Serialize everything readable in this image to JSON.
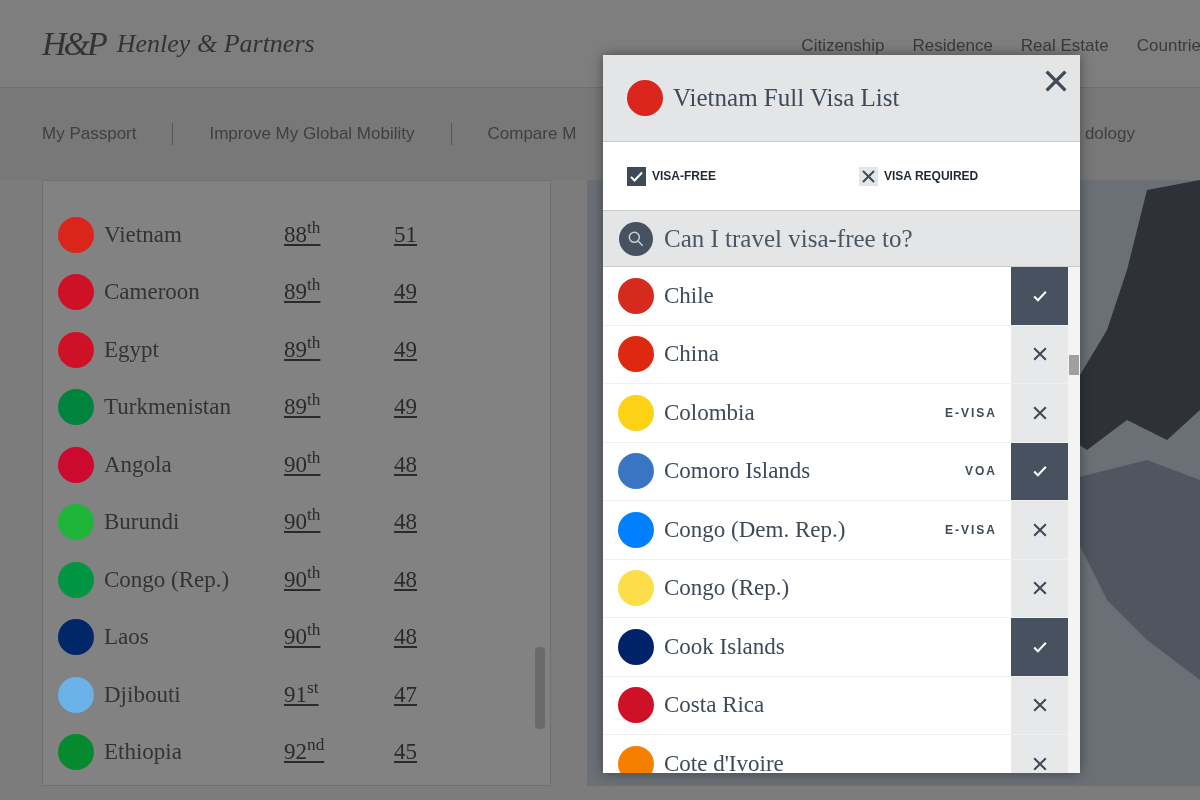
{
  "header": {
    "logo_mark": "H&P",
    "brand": "Henley & Partners",
    "nav": [
      "Citizenship",
      "Residence",
      "Real Estate",
      "Countrie"
    ]
  },
  "subnav": {
    "items": [
      "My Passport",
      "Improve My Global Mobility",
      "Compare M"
    ],
    "right_item": "dology"
  },
  "ranking": {
    "rows": [
      {
        "country": "Vietnam",
        "rank": "88$^{th}$",
        "score": "51",
        "color": "#da251d"
      },
      {
        "country": "Cameroon",
        "rank": "89$^{th}$",
        "score": "49",
        "color": "#ce1126"
      },
      {
        "country": "Egypt",
        "rank": "89$^{th}$",
        "score": "49",
        "color": "#ce1126"
      },
      {
        "country": "Turkmenistan",
        "rank": "89$^{th}$",
        "score": "49",
        "color": "#00843d"
      },
      {
        "country": "Angola",
        "rank": "90$^{th}$",
        "score": "48",
        "color": "#cc092f"
      },
      {
        "country": "Burundi",
        "rank": "90$^{th}$",
        "score": "48",
        "color": "#1eb53a"
      },
      {
        "country": "Congo (Rep.)",
        "rank": "90$^{th}$",
        "score": "48",
        "color": "#009543"
      },
      {
        "country": "Laos",
        "rank": "90$^{th}$",
        "score": "48",
        "color": "#002868"
      },
      {
        "country": "Djibouti",
        "rank": "91$^{st}$",
        "score": "47",
        "color": "#6ab2e7"
      },
      {
        "country": "Ethiopia",
        "rank": "92$^{nd}$",
        "score": "45",
        "color": "#078930"
      }
    ]
  },
  "modal": {
    "title": "Vietnam Full Visa List",
    "color": "#da251d",
    "legend": [
      {
        "kind": "check",
        "label": "VISA-FREE"
      },
      {
        "kind": "cross",
        "label": "VISA REQUIRED"
      }
    ],
    "search": {
      "placeholder": "Can I travel visa-free to?"
    },
    "rows": [
      {
        "country": "Chile",
        "visa_free": true,
        "color": "#d52b1e"
      },
      {
        "country": "China",
        "visa_free": false,
        "color": "#de2910"
      },
      {
        "country": "Colombia",
        "tag": "E-VISA",
        "visa_free": false,
        "color": "#fcd116"
      },
      {
        "country": "Comoro Islands",
        "tag": "VOA",
        "visa_free": true,
        "color": "#3a75c4"
      },
      {
        "country": "Congo (Dem. Rep.)",
        "tag": "E-VISA",
        "visa_free": false,
        "color": "#007fff"
      },
      {
        "country": "Congo (Rep.)",
        "visa_free": false,
        "color": "#fbde4a"
      },
      {
        "country": "Cook Islands",
        "visa_free": true,
        "color": "#012169"
      },
      {
        "country": "Costa Rica",
        "visa_free": false,
        "color": "#ce1126"
      },
      {
        "country": "Cote d'Ivoire",
        "visa_free": false,
        "color": "#f77f00"
      }
    ]
  }
}
